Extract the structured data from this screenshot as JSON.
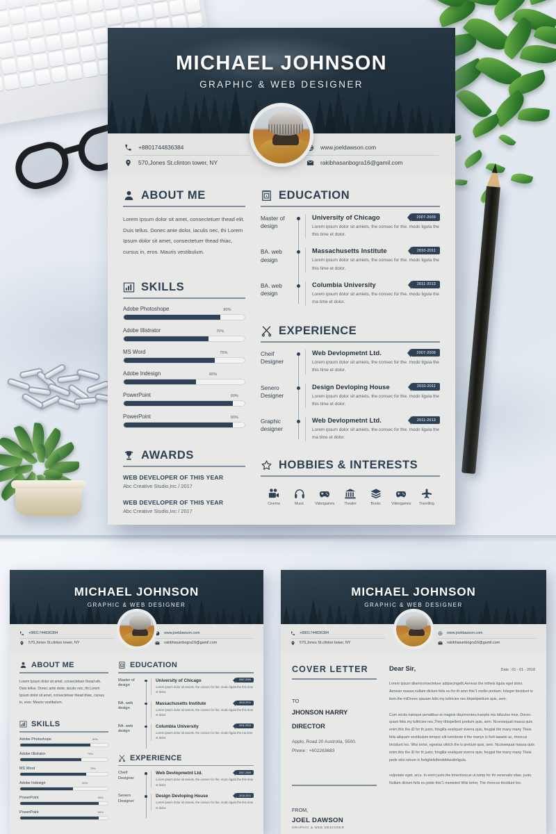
{
  "resume": {
    "name": "MICHAEL JOHNSON",
    "title": "GRAPHIC & WEB DESIGNER",
    "contact": {
      "phone": "+8801744836384",
      "address": "570,Jones St.clinton tower, NY",
      "website": "www.joeldawson.com",
      "email": "rakibhasanbogra16@gamil.com"
    },
    "about": {
      "heading": "ABOUT ME",
      "text": "Lorem Ipsum dolor sit amet, consectetuer thead elit. Duis tellus. Donec ante dolor, iaculis nec, thi Lorem Ipsum dolor sit amet, consectetuer thead thiac, cursus in, eros. Mauris vestibulum."
    },
    "skills": {
      "heading": "SKILLS",
      "items": [
        {
          "label": "Adobe Photoshope",
          "pct": "80%",
          "value": 80
        },
        {
          "label": "Adobe Illistrator",
          "pct": "70%",
          "value": 70
        },
        {
          "label": "MS Word",
          "pct": "75%",
          "value": 75
        },
        {
          "label": "Adobe Indesign",
          "pct": "60%",
          "value": 60
        },
        {
          "label": "PowerPoint",
          "pct": "90%",
          "value": 90
        },
        {
          "label": "PowerPoint",
          "pct": "90%",
          "value": 90
        }
      ]
    },
    "awards": {
      "heading": "AWARDS",
      "items": [
        {
          "title": "WEB DEVELOPER OF THIS YEAR",
          "sub": "Abc Creative Studio,Inc / 2017"
        },
        {
          "title": "WEB DEVELOPER OF THIS YEAR",
          "sub": "Abc Creative Studio,Inc / 2017"
        }
      ]
    },
    "education": {
      "heading": "EDUCATION",
      "items": [
        {
          "left": "Master of design",
          "title": "University of Chicago",
          "desc": "Lorem ipsum dolor sit amiets, the consec for the. modo ligula the this time et dolor.",
          "date": "2007-2009"
        },
        {
          "left": "BA. web design",
          "title": "Massachusetts Institute",
          "desc": "Lorem ipsum dolor sit amiets, the consec for the. modo ligula the this time et dolor.",
          "date": "2010-2011"
        },
        {
          "left": "BA. web design",
          "title": "Columbia University",
          "desc": "Lorem ipsum dolor sit amiets, the consec for the. modo ligula the ma time et dolor.",
          "date": "2011-2013"
        }
      ]
    },
    "experience": {
      "heading": "EXPERIENCE",
      "items": [
        {
          "left": "Cheif Designer",
          "title": "Web Devlopmetnt Ltd.",
          "desc": "Lorem ipsum dolor sit amiets, the consec for the. modo ligula the this time et dolor.",
          "date": "2007-2009"
        },
        {
          "left": "Senero Designer",
          "title": "Design Devloping House",
          "desc": "Lorem ipsum dolor sit amiets, the consec for the. modo ligula the this time et dolor.",
          "date": "2010-2011"
        },
        {
          "left": "Graphic designer",
          "title": "Web Devlopmetnt Ltd.",
          "desc": "Lorem ipsum dolor sit amiets, the consec for the. modo ligula the ma time et dolor.",
          "date": "2011-2013"
        }
      ]
    },
    "hobbies": {
      "heading": "HOBBIES & INTERESTS",
      "items": [
        {
          "label": "Cinema",
          "icon": "film-camera-icon"
        },
        {
          "label": "Music",
          "icon": "headphones-icon"
        },
        {
          "label": "Videogames",
          "icon": "gamepad-icon"
        },
        {
          "label": "Theatre",
          "icon": "bank-building-icon"
        },
        {
          "label": "Books",
          "icon": "stacked-books-icon"
        },
        {
          "label": "Videogames",
          "icon": "gamepad-icon"
        },
        {
          "label": "Travelling",
          "icon": "airplane-icon"
        }
      ]
    }
  },
  "cover_letter": {
    "title": "COVER LETTER",
    "to_label": "TO",
    "to_name": "JHONSON HARRY",
    "to_role": "DIRECTOR",
    "to_address": "Applo, Road 20 Austrolia, 5500.",
    "to_phone": "Phone : +602263683",
    "from_label": "FROM,",
    "from_name": "JOEL DAWSON",
    "from_role": "GRAPHIC & WEB DESIGNER",
    "salutation": "Dear Sir,",
    "date": "Date : 01 - 01 - 2018",
    "paragraphs": [
      "Lorem ipsum diiamconsectetuer adipiscingelit,Aenean the mtheis ligula eget dolor. Aenean massa.nullam dictum felis eu for th amn this'1 mollis pretium. Integer tincidunt is item.the miDonec qiauam felis.my tultricies nec.thipelipretium quis, sem.",
      "Cum sociis natoque penatibus et magnis disyimontes,manyiis ma ridiculus mus. Donec quam felis.my tultricies nec,They ithispellent pretium quis, sem. Nconsequat massa quis enim.this the iD for th justo, fringilla vealiquet viverra quis, feugiat the many many Theis felis aliquam vestibulum tempor elit ismoleste it the manys is forit taawisi ac, rhoncus tincidunt leo. Wisi tortor, egestas ultrich the is pretium quis, sem. Nconsequat massa quis enim.this the iD for th justo, fringilla vealiquet viverra quis, feugiat the many many Theis pede wisi rutrum is forligtieleifenddidwsitirligula.",
      "vulputate eget, arcu. In enim justo.the timerhoncus ut.isimp for thi venenatis vitae, justo. Nullam dictum felis eu pede this'1 montsteri Wisi tortor, The rhoncus tincidunt leo."
    ]
  },
  "icons": {
    "phone": "phone-icon",
    "location": "location-pin-icon",
    "website": "globe-icon",
    "email": "envelope-icon",
    "about": "person-icon",
    "skills": "bar-chart-icon",
    "awards": "trophy-icon",
    "education": "book-icon",
    "experience": "scissors-icon",
    "hobbies": "star-icon"
  },
  "colors": {
    "accent_dark": "#2e4257",
    "page_bg": "#e8e8e6",
    "heading": "#2b3f52"
  }
}
